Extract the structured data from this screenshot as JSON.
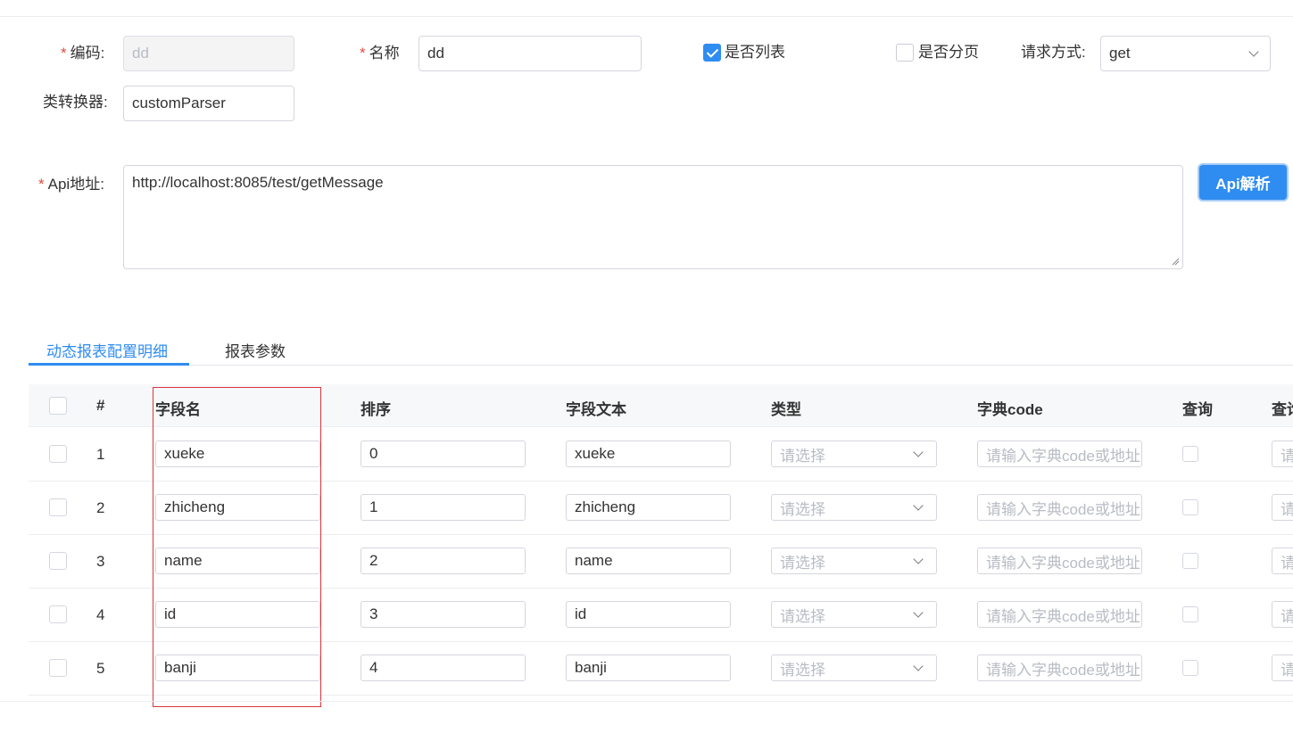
{
  "form": {
    "code_label": "编码:",
    "code_value": "dd",
    "name_label": "名称",
    "name_value": "dd",
    "is_list_label": "是否列表",
    "is_list_checked": true,
    "is_page_label": "是否分页",
    "is_page_checked": false,
    "method_label": "请求方式:",
    "method_value": "get",
    "converter_label": "类转换器:",
    "converter_value": "customParser",
    "api_label": "Api地址:",
    "api_value": "http://localhost:8085/test/getMessage",
    "api_parse_button": "Api解析",
    "required_mark": "*",
    "accent_color": "#2f8cf0",
    "required_color": "#e64a3b"
  },
  "tabs": [
    {
      "label": "动态报表配置明细",
      "active": true
    },
    {
      "label": "报表参数",
      "active": false
    }
  ],
  "table": {
    "columns": [
      "#",
      "字段名",
      "排序",
      "字段文本",
      "类型",
      "字典code",
      "查询",
      "查询"
    ],
    "type_placeholder": "请选择",
    "dict_placeholder": "请输入字典code或地址",
    "rows": [
      {
        "index": "1",
        "field": "xueke",
        "order": "0",
        "text": "xueke"
      },
      {
        "index": "2",
        "field": "zhicheng",
        "order": "1",
        "text": "zhicheng"
      },
      {
        "index": "3",
        "field": "name",
        "order": "2",
        "text": "name"
      },
      {
        "index": "4",
        "field": "id",
        "order": "3",
        "text": "id"
      },
      {
        "index": "5",
        "field": "banji",
        "order": "4",
        "text": "banji"
      }
    ]
  }
}
